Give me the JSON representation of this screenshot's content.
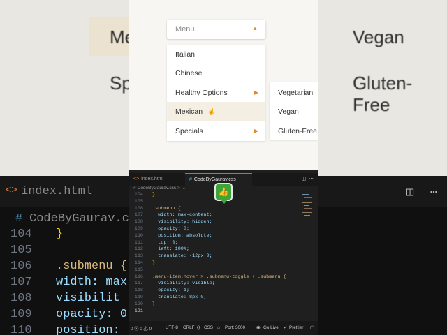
{
  "background": {
    "top_left_texts": [
      "Me",
      "Sp"
    ],
    "top_right_texts": [
      "Vegan",
      "Gluten-Free"
    ],
    "editor_tab": "index.html",
    "editor_file": "CodeByGaurav.css",
    "line_numbers": [
      "104",
      "105",
      "106",
      "107",
      "108",
      "109",
      "110"
    ],
    "code_lines": [
      "}",
      "",
      ".submenu {",
      "  width: max",
      "  visibilit",
      "  opacity: 0",
      "  position:"
    ]
  },
  "preview": {
    "menu_label": "Menu",
    "caret_icon": "caret-up-icon",
    "items": [
      {
        "label": "Italian",
        "has_submenu": false
      },
      {
        "label": "Chinese",
        "has_submenu": false
      },
      {
        "label": "Healthy Options",
        "has_submenu": true
      },
      {
        "label": "Mexican",
        "has_submenu": false,
        "hovered": true
      },
      {
        "label": "Specials",
        "has_submenu": true
      }
    ],
    "submenu_items": [
      "Vegetarian",
      "Vegan",
      "Gluten-Free"
    ]
  },
  "editor": {
    "tabs": [
      "index.html",
      "CodeByGaurav.css"
    ],
    "active_tab": "CodeByGaurav.css",
    "breadcrumb": "CodeByGaurav.css > ...",
    "tab_icons": [
      "split-editor-icon",
      "more-actions-icon"
    ],
    "lines": [
      {
        "num": "104",
        "text": "}"
      },
      {
        "num": "105",
        "text": ""
      },
      {
        "num": "106",
        "text": ".submenu {"
      },
      {
        "num": "107",
        "text": "  width: max-content;"
      },
      {
        "num": "108",
        "text": "  visibility: hidden;"
      },
      {
        "num": "109",
        "text": "  opacity: 0;"
      },
      {
        "num": "110",
        "text": "  position: absolute;"
      },
      {
        "num": "111",
        "text": "  top: 0;"
      },
      {
        "num": "112",
        "text": "  left: 100%;"
      },
      {
        "num": "113",
        "text": "  translate: -12px 0;"
      },
      {
        "num": "114",
        "text": "}"
      },
      {
        "num": "115",
        "text": ""
      },
      {
        "num": "116",
        "text": ".menu-item:hover > .submenu-toggle + .submenu {"
      },
      {
        "num": "117",
        "text": "  visibility: visible;"
      },
      {
        "num": "118",
        "text": "  opacity: 1;"
      },
      {
        "num": "119",
        "text": "  translate: 8px 0;"
      },
      {
        "num": "120",
        "text": "}"
      },
      {
        "num": "121",
        "text": ""
      }
    ],
    "status": {
      "problems": "0 ⓧ 0 ⚠ 0",
      "encoding": "UTF-8",
      "eol": "CRLF",
      "language": "CSS",
      "port": "Port: 3000",
      "golive": "Go Live",
      "prettier": "Prettier"
    }
  },
  "colors": {
    "accent": "#e08a2a",
    "hover_bg": "#f4efe2",
    "selector": "#d7ba7d",
    "property": "#9cdcfe",
    "value": "#ce9178",
    "brace": "#ffd700"
  }
}
